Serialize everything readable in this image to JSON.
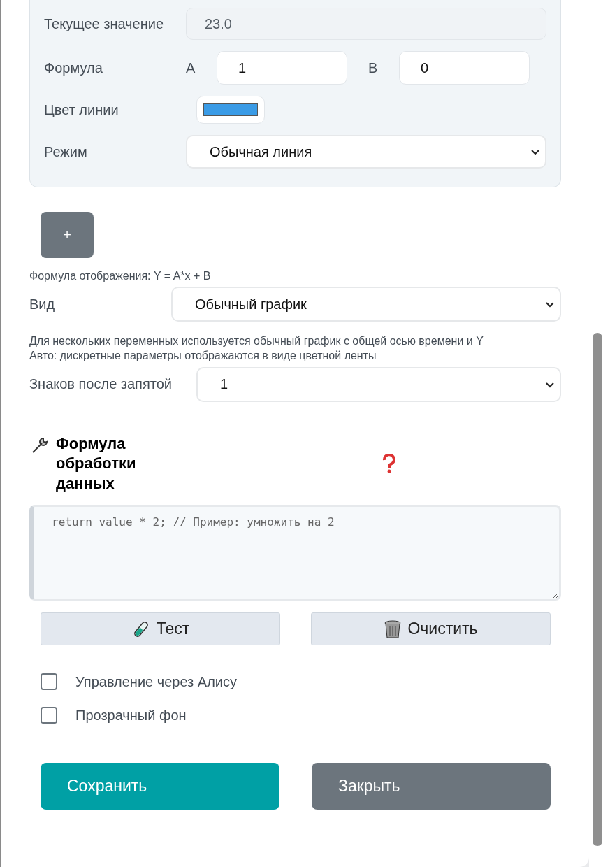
{
  "series_card": {
    "current_value": {
      "label": "Текущее значение",
      "value": "23.0"
    },
    "formula": {
      "label": "Формула",
      "a_label": "A",
      "a_value": "1",
      "b_label": "B",
      "b_value": "0"
    },
    "line_color": {
      "label": "Цвет линии",
      "color": "#3a9be6"
    },
    "mode": {
      "label": "Режим",
      "value": "Обычная линия"
    }
  },
  "add_button": "+",
  "formula_hint": "Формула отображения: Y = A*x + B",
  "view": {
    "label": "Вид",
    "value": "Обычный график"
  },
  "view_notes": [
    "Для нескольких переменных используется обычный график с общей осью времени и Y",
    "Авто: дискретные параметры отображаются в виде цветной ленты"
  ],
  "decimals": {
    "label": "Знаков после запятой",
    "value": "1"
  },
  "processing": {
    "title": "Формула обработки данных",
    "placeholder": "return value * 2; // Пример: умножить на 2",
    "buttons": [
      {
        "kind": "test",
        "label": "Тест"
      },
      {
        "kind": "clear",
        "label": "Очистить"
      }
    ]
  },
  "options": [
    {
      "label": "Управление через Алису",
      "checked": false
    },
    {
      "label": "Прозрачный фон",
      "checked": false
    }
  ],
  "actions": [
    {
      "kind": "primary",
      "label": "Сохранить"
    },
    {
      "kind": "secondary",
      "label": "Закрыть"
    }
  ]
}
